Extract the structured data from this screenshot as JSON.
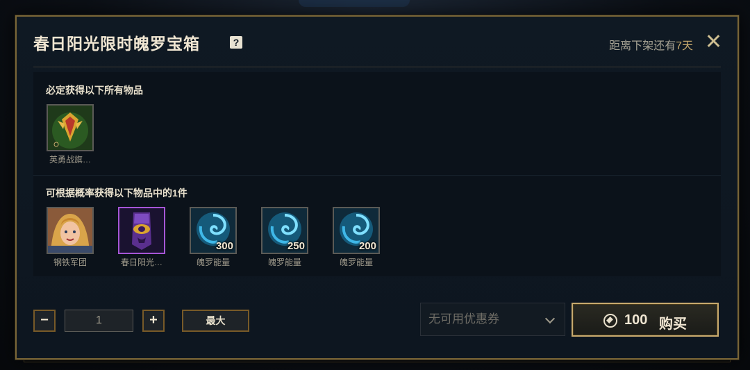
{
  "dialog": {
    "title": "春日阳光限时魄罗宝箱",
    "help_icon": "?",
    "timer_prefix": "距离下架还有",
    "timer_days": "7天"
  },
  "guaranteed": {
    "title": "必定获得以下所有物品",
    "items": [
      {
        "label": "英勇战旗…",
        "icon": "banner-emblem-icon"
      }
    ]
  },
  "random": {
    "title": "可根据概率获得以下物品中的1件",
    "items": [
      {
        "label": "钢铁军团",
        "icon": "champion-skin-portrait",
        "qty": ""
      },
      {
        "label": "春日阳光…",
        "icon": "purple-banner-icon",
        "qty": ""
      },
      {
        "label": "魄罗能量",
        "icon": "poro-energy-swirl-icon",
        "qty": "300"
      },
      {
        "label": "魄罗能量",
        "icon": "poro-energy-swirl-icon",
        "qty": "250"
      },
      {
        "label": "魄罗能量",
        "icon": "poro-energy-swirl-icon",
        "qty": "200"
      }
    ]
  },
  "purchase": {
    "minus_label": "−",
    "quantity": "1",
    "plus_label": "+",
    "max_label": "最大",
    "coupon_placeholder": "无可用优惠券",
    "price": "100",
    "buy_label": "购买"
  },
  "colors": {
    "gold_border": "#c8aa6e",
    "accent_days": "#c8aa6e",
    "rare_border": "#a656d6"
  }
}
